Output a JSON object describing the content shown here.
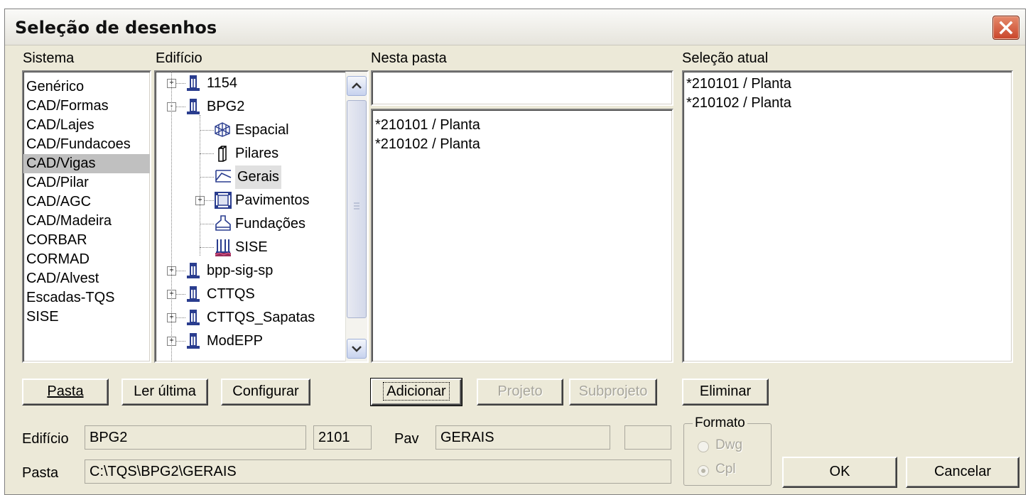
{
  "window": {
    "title": "Seleção de desenhos",
    "close_label": "X"
  },
  "labels": {
    "sistema": "Sistema",
    "edificio_tree": "Edifício",
    "nesta_pasta": "Nesta pasta",
    "selecao_atual": "Seleção atual"
  },
  "sistema_list": [
    "Genérico",
    "CAD/Formas",
    "CAD/Lajes",
    "CAD/Fundacoes",
    "CAD/Vigas",
    "CAD/Pilar",
    "CAD/AGC",
    "CAD/Madeira",
    "CORBAR",
    "CORMAD",
    "CAD/Alvest",
    "Escadas-TQS",
    "SISE"
  ],
  "sistema_selected": "CAD/Vigas",
  "tree": [
    {
      "label": "1154",
      "icon": "building-icon",
      "level": 0,
      "expander": "+"
    },
    {
      "label": "BPG2",
      "icon": "building-icon",
      "level": 0,
      "expander": "-"
    },
    {
      "label": "Espacial",
      "icon": "spatial-frame-icon",
      "level": 1,
      "expander": ""
    },
    {
      "label": "Pilares",
      "icon": "column-icon",
      "level": 1,
      "expander": ""
    },
    {
      "label": "Gerais",
      "icon": "general-drawing-icon",
      "level": 1,
      "expander": "",
      "selected": true
    },
    {
      "label": "Pavimentos",
      "icon": "floor-icon",
      "level": 1,
      "expander": "+"
    },
    {
      "label": "Fundações",
      "icon": "foundation-icon",
      "level": 1,
      "expander": ""
    },
    {
      "label": "SISE",
      "icon": "sise-icon",
      "level": 1,
      "expander": ""
    },
    {
      "label": "bpp-sig-sp",
      "icon": "building-icon",
      "level": 0,
      "expander": "+"
    },
    {
      "label": "CTTQS",
      "icon": "building-icon",
      "level": 0,
      "expander": "+"
    },
    {
      "label": "CTTQS_Sapatas",
      "icon": "building-icon",
      "level": 0,
      "expander": "+"
    },
    {
      "label": "ModEPP",
      "icon": "building-icon",
      "level": 0,
      "expander": "+"
    }
  ],
  "nesta_pasta": {
    "filter_value": "",
    "items": [
      "*210101 / Planta",
      "*210102 / Planta"
    ]
  },
  "selecao_atual": {
    "items": [
      "*210101 / Planta",
      "*210102 / Planta"
    ]
  },
  "buttons": {
    "pasta": "Pasta",
    "ler_ultima": "Ler última",
    "configurar": "Configurar",
    "adicionar": "Adicionar",
    "projeto": "Projeto",
    "subprojeto": "Subprojeto",
    "eliminar": "Eliminar",
    "ok": "OK",
    "cancelar": "Cancelar"
  },
  "fields": {
    "edificio_label": "Edifício",
    "edificio_value": "BPG2",
    "numero_value": "2101",
    "pav_label": "Pav",
    "pav_value": "GERAIS",
    "extra_value": "",
    "pasta_label": "Pasta",
    "pasta_value": "C:\\TQS\\BPG2\\GERAIS"
  },
  "formato": {
    "title": "Formato",
    "options": [
      "Dwg",
      "Cpl"
    ],
    "selected": "Cpl",
    "enabled": false
  },
  "colors": {
    "selection_gray": "#c0c0c0",
    "dialog_bg": "#ece9d8",
    "close_red": "#c9452a",
    "disabled_text": "#a8a69c"
  }
}
